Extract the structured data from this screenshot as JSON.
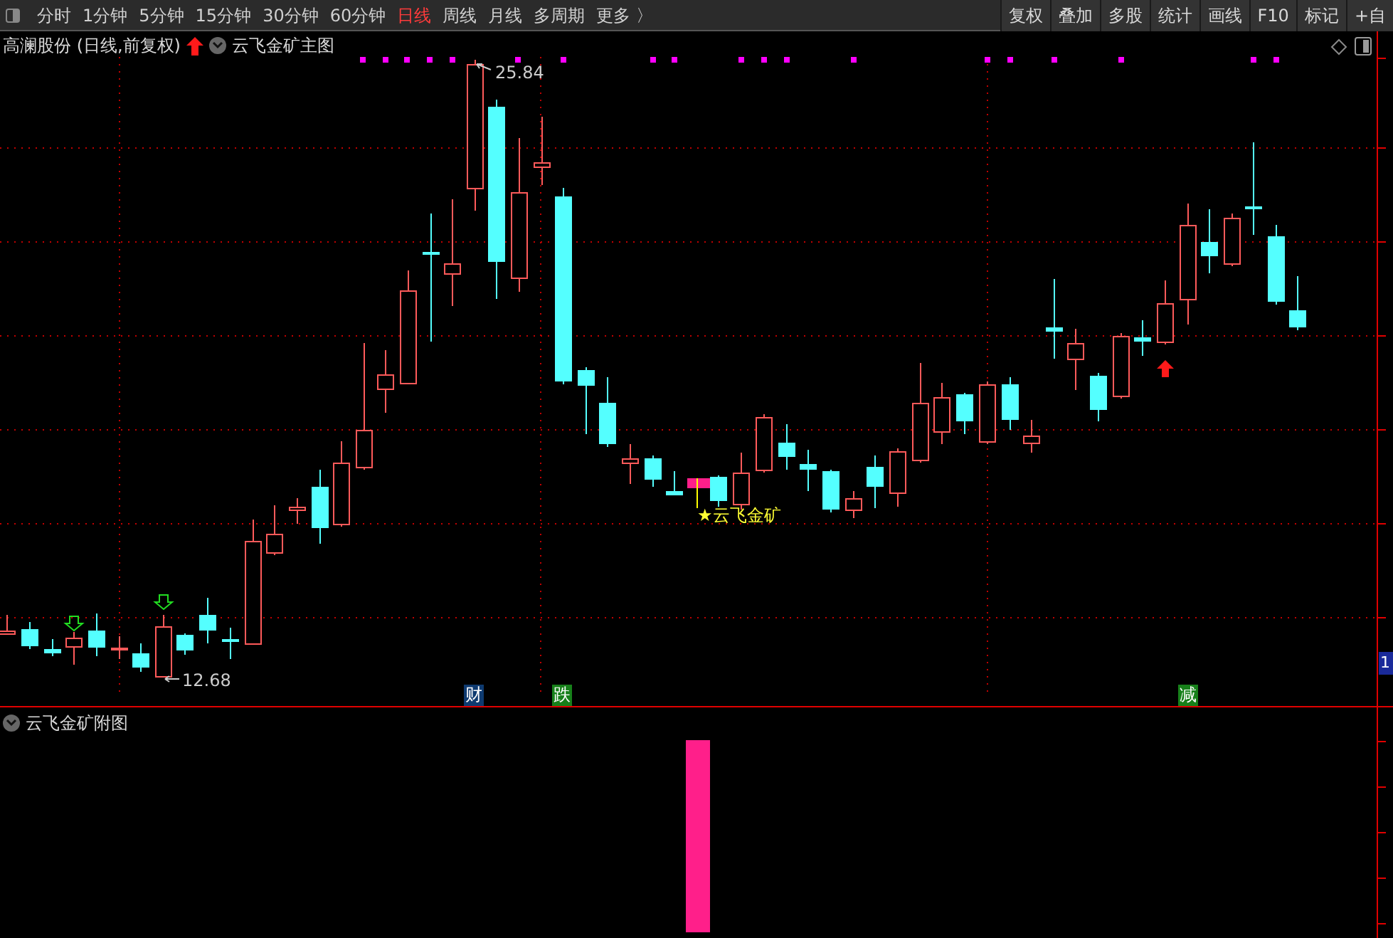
{
  "toolbar": {
    "periods": [
      {
        "label": "分时",
        "selected": false
      },
      {
        "label": "1分钟",
        "selected": false
      },
      {
        "label": "5分钟",
        "selected": false
      },
      {
        "label": "15分钟",
        "selected": false
      },
      {
        "label": "30分钟",
        "selected": false
      },
      {
        "label": "60分钟",
        "selected": false
      },
      {
        "label": "日线",
        "selected": true
      },
      {
        "label": "周线",
        "selected": false
      },
      {
        "label": "月线",
        "selected": false
      },
      {
        "label": "多周期",
        "selected": false
      }
    ],
    "more": "更多 〉",
    "buttons": [
      "复权",
      "叠加",
      "多股",
      "统计",
      "画线",
      "F10",
      "标记",
      "+自"
    ]
  },
  "main_chart": {
    "stock": "高澜股份 (日线,前复权)",
    "indicator": "云飞金矿主图",
    "high_label": "25.84",
    "low_label": "12.68",
    "signal_label": "★云飞金矿",
    "axis_label": "1",
    "event_tags": [
      {
        "text": "财",
        "color": "#0e3a70"
      },
      {
        "text": "跌",
        "color": "#17801a"
      },
      {
        "text": "减",
        "color": "#17801a"
      }
    ]
  },
  "sub_chart": {
    "indicator": "云飞金矿附图"
  }
}
